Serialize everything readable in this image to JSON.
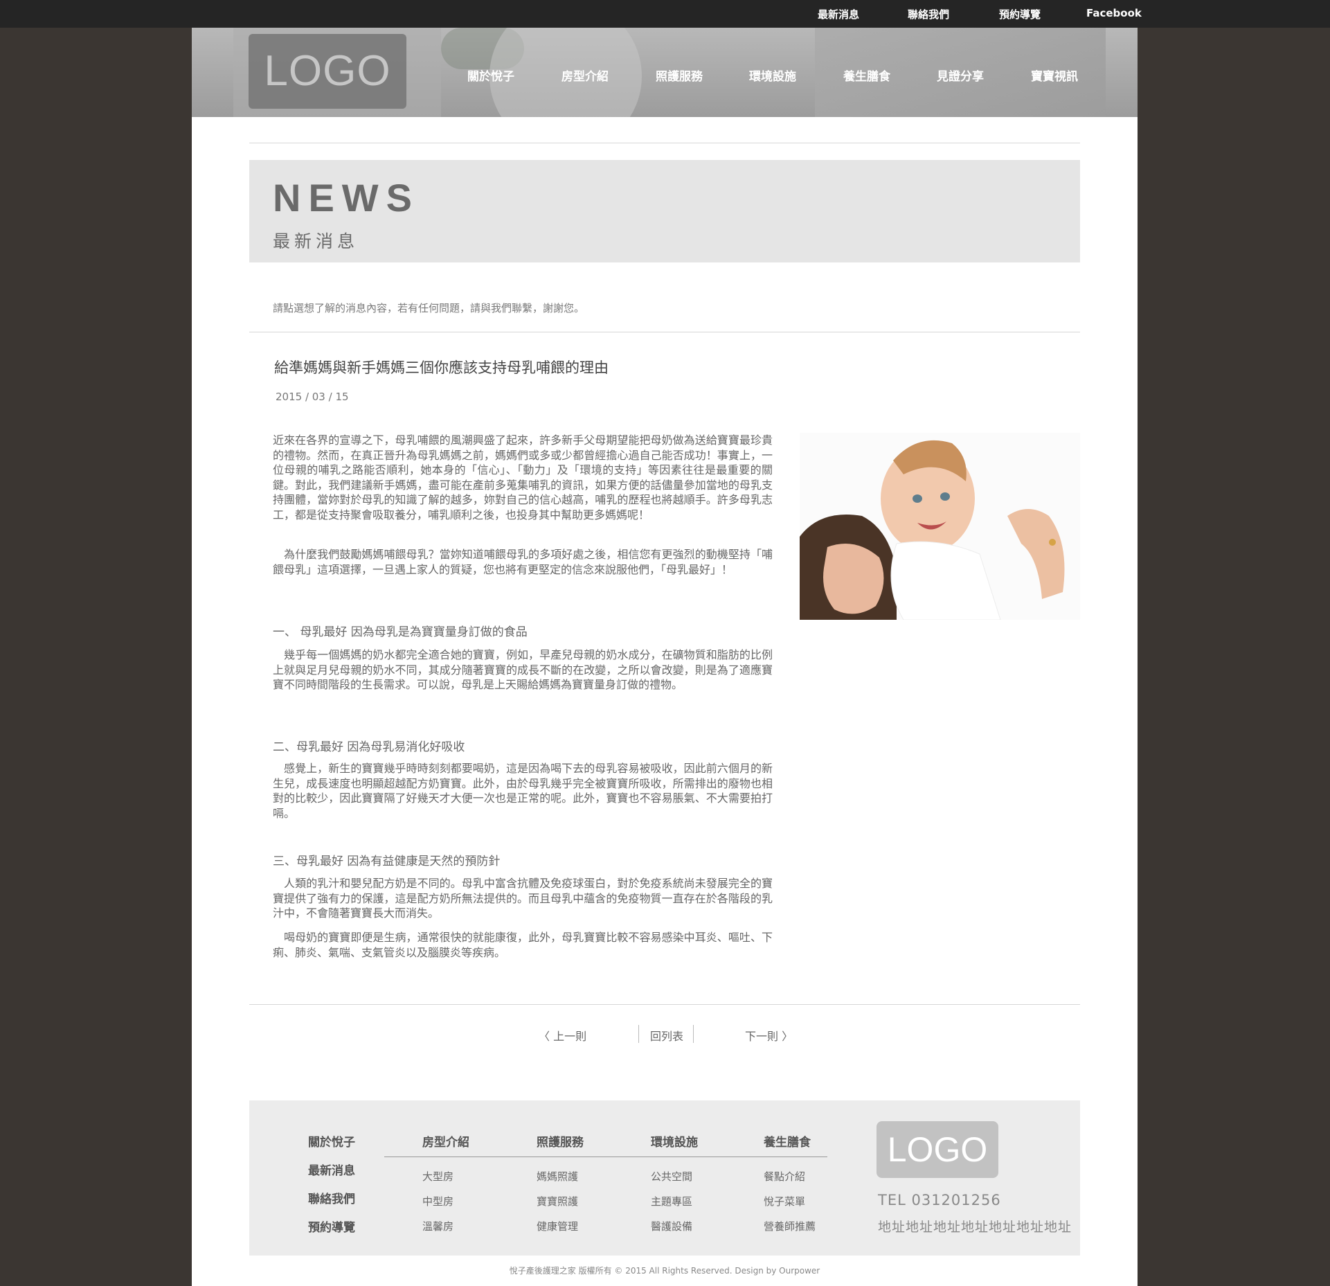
{
  "top_links": [
    "最新消息",
    "聯絡我們",
    "預約導覽",
    "Facebook"
  ],
  "logo_text": "LOGO",
  "main_nav": [
    "關於悅子",
    "房型介紹",
    "照護服務",
    "環境設施",
    "養生膳食",
    "見證分享",
    "寶寶視訊"
  ],
  "news_banner": {
    "title": "NEWS",
    "subtitle": "最新消息"
  },
  "intro_text": "請點選想了解的消息內容，若有任何問題，請與我們聯繫，謝謝您。",
  "article": {
    "title": "給準媽媽與新手媽媽三個你應該支持母乳哺餵的理由",
    "date": "2015 / 03 / 15",
    "intro_p1": "近來在各界的宣導之下，母乳哺餵的風潮興盛了起來，許多新手父母期望能把母奶做為送給寶寶最珍貴的禮物。然而，在真正晉升為母乳媽媽之前，媽媽們或多或少都曾經擔心過自己能否成功！事實上，一位母親的哺乳之路能否順利，她本身的「信心」、「動力」及「環境的支持」等因素往往是最重要的關鍵。對此，我們建議新手媽媽，盡可能在產前多蒐集哺乳的資訊，如果方便的話儘量參加當地的母乳支持團體，當妳對於母乳的知識了解的越多，妳對自己的信心越高，哺乳的歷程也將越順手。許多母乳志工，都是從支持聚會吸取養分，哺乳順利之後，也投身其中幫助更多媽媽呢！",
    "intro_p2": "　為什麼我們鼓勵媽媽哺餵母乳？當妳知道哺餵母乳的多項好處之後，相信您有更強烈的動機堅持「哺餵母乳」這項選擇，一旦遇上家人的質疑，您也將有更堅定的信念來說服他們，「母乳最好」！",
    "s1_heading": "一、 母乳最好  因為母乳是為寶寶量身訂做的食品",
    "s1_body": "　幾乎每一個媽媽的奶水都完全適合她的寶寶，例如，早產兒母親的奶水成分，在礦物質和脂肪的比例上就與足月兒母親的奶水不同，其成分隨著寶寶的成長不斷的在改變，之所以會改變，則是為了適應寶寶不同時間階段的生長需求。可以說，母乳是上天賜給媽媽為寶寶量身訂做的禮物。",
    "s2_heading": "二、母乳最好 因為母乳易消化好吸收",
    "s2_body": "　感覺上，新生的寶寶幾乎時時刻刻都要喝奶，這是因為喝下去的母乳容易被吸收，因此前六個月的新生兒，成長速度也明顯超越配方奶寶寶。此外，由於母乳幾乎完全被寶寶所吸收，所需排出的廢物也相對的比較少，因此寶寶隔了好幾天才大便一次也是正常的呢。此外，寶寶也不容易脹氣、不大需要拍打嗝。",
    "s3_heading": "三、母乳最好 因為有益健康是天然的預防針",
    "s3_body1": "　人類的乳汁和嬰兒配方奶是不同的。母乳中富含抗體及免疫球蛋白，對於免疫系統尚未發展完全的寶寶提供了強有力的保護，這是配方奶所無法提供的。而且母乳中蘊含的免疫物質一直存在於各階段的乳汁中，不會隨著寶寶長大而消失。",
    "s3_body2": "　喝母奶的寶寶即便是生病，通常很快的就能康復，此外，母乳寶寶比較不容易感染中耳炎、嘔吐、下痢、肺炎、氣喘、支氣管炎以及腦膜炎等疾病。"
  },
  "pager": {
    "prev": "〈 上一則",
    "list": "回列表",
    "next": "下一則 〉"
  },
  "footer": {
    "left_links": [
      "關於悅子",
      "最新消息",
      "聯絡我們",
      "預約導覽"
    ],
    "columns": [
      {
        "title": "房型介紹",
        "items": [
          "大型房",
          "中型房",
          "溫馨房"
        ]
      },
      {
        "title": "照護服務",
        "items": [
          "媽媽照護",
          "寶寶照護",
          "健康管理"
        ]
      },
      {
        "title": "環境設施",
        "items": [
          "公共空間",
          "主題專區",
          "醫護設備"
        ]
      },
      {
        "title": "養生膳食",
        "items": [
          "餐點介紹",
          "悅子菜單",
          "營養師推薦"
        ]
      }
    ],
    "logo_text": "LOGO",
    "tel": "TEL  031201256",
    "address": "地址地址地址地址地址地址地址"
  },
  "copyright": "悅子產後護理之家 版權所有 © 2015  All Rights Reserved. Design by Ourpower",
  "colors": {
    "bg": "#3b3632",
    "topbar": "#252525",
    "banner": "#e5e5e5",
    "footer": "#ececec"
  }
}
